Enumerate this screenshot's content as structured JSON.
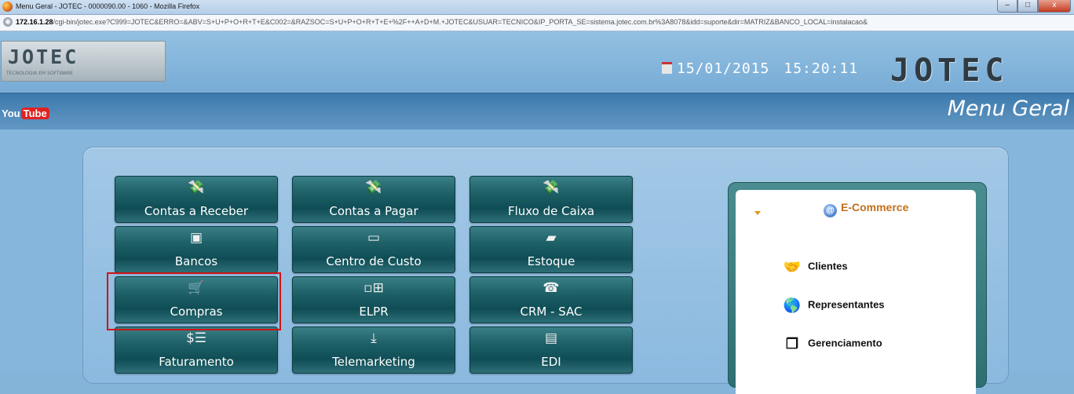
{
  "window": {
    "title": "Menu Geral - JOTEC - 0000090.00 - 1060 - Mozilla Firefox",
    "minimize": "–",
    "maximize": "□",
    "close": "x"
  },
  "address_bar": {
    "host": "172.16.1.28",
    "path": "/cgi-bin/jotec.exe?C999=JOTEC&ERRO=&ABV=S+U+P+O+R+T+E&C002=&RAZSOC=S+U+P+O+R+T+E+%2F++A+D+M.+JOTEC&USUAR=TECNICO&IP_PORTA_SE=sistema.jotec.com.br%3A8078&idd=suporte&dir=MATRIZ&BANCO_LOCAL=instalacao&"
  },
  "header": {
    "logo_text": "JOTEC",
    "logo_subtitle": "TECNOLOGIA EM SOFTWARE",
    "date": "15/01/2015",
    "time": "15:20:11",
    "brand": "JOTEC"
  },
  "navbar": {
    "youtube_you": "You",
    "youtube_tube": "Tube",
    "title": "Menu Geral"
  },
  "modules": [
    {
      "label": "Contas a Receber",
      "icon": "money-hand-icon",
      "glyph": "💸"
    },
    {
      "label": "Contas a Pagar",
      "icon": "money-hand-icon",
      "glyph": "💸"
    },
    {
      "label": "Fluxo de Caixa",
      "icon": "money-hand-icon",
      "glyph": "💸"
    },
    {
      "label": "Bancos",
      "icon": "cash-register-icon",
      "glyph": "▣"
    },
    {
      "label": "Centro de Custo",
      "icon": "folder-icon",
      "glyph": "▭"
    },
    {
      "label": "Estoque",
      "icon": "box-icon",
      "glyph": "▰"
    },
    {
      "label": "Compras",
      "icon": "shopping-cart-icon",
      "glyph": "🛒"
    },
    {
      "label": "ELPR",
      "icon": "network-icon",
      "glyph": "▫⊞"
    },
    {
      "label": "CRM - SAC",
      "icon": "telephone-icon",
      "glyph": "☎"
    },
    {
      "label": "Faturamento",
      "icon": "invoice-icon",
      "glyph": "$☰"
    },
    {
      "label": "Telemarketing",
      "icon": "phone-hand-icon",
      "glyph": "⤓"
    },
    {
      "label": "EDI",
      "icon": "document-icon",
      "glyph": "▤"
    }
  ],
  "ecommerce": {
    "title": "E-Commerce",
    "at_symbol": "@",
    "items": [
      {
        "label": "Clientes",
        "icon": "handshake-icon",
        "glyph": "🤝"
      },
      {
        "label": "Representantes",
        "icon": "globe-icon",
        "glyph": "🌎"
      },
      {
        "label": "Gerenciamento",
        "icon": "copy-icon",
        "glyph": "❐"
      }
    ]
  },
  "colors": {
    "tile": "#1f6168",
    "highlight": "#d01414",
    "ecommerce_title": "#c3701a",
    "navbar": "#3c79ad"
  }
}
